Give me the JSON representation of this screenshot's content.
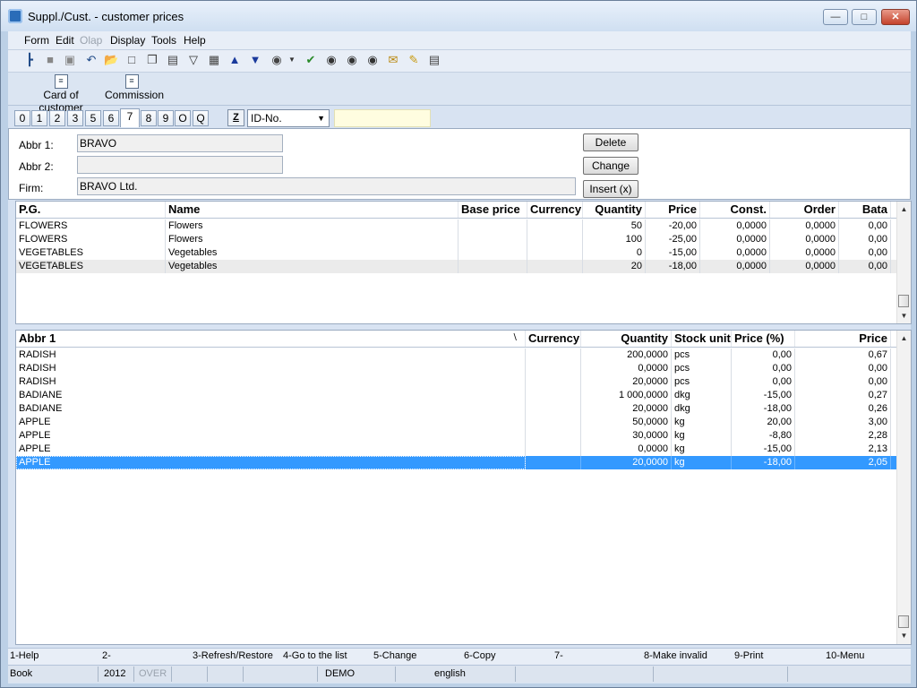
{
  "window": {
    "title": "Suppl./Cust. - customer prices"
  },
  "menu": {
    "items": [
      "Form",
      "Edit",
      "Olap",
      "Display",
      "Tools",
      "Help"
    ]
  },
  "toolbar2": {
    "card_of_customer": "Card of customer",
    "commission": "Commission"
  },
  "tabs": [
    "0",
    "1",
    "2",
    "3",
    "5",
    "6",
    "7",
    "8",
    "9",
    "O",
    "Q"
  ],
  "active_tab": "7",
  "filter": {
    "z_label": "Z",
    "select_value": "ID-No."
  },
  "form": {
    "abbr1_label": "Abbr 1:",
    "abbr1_value": "BRAVO",
    "abbr2_label": "Abbr 2:",
    "abbr2_value": "",
    "firm_label": "Firm:",
    "firm_value": "BRAVO Ltd.",
    "delete_label": "Delete",
    "change_label": "Change",
    "insert_label": "Insert (x)"
  },
  "grid1": {
    "headers": [
      "P.G.",
      "Name",
      "Base price",
      "Currency",
      "Quantity",
      "Price",
      "Const.",
      "Order",
      "Bata"
    ],
    "rows": [
      [
        "FLOWERS",
        "Flowers",
        "",
        "",
        "50",
        "-20,00",
        "0,0000",
        "0,0000",
        "0,00"
      ],
      [
        "FLOWERS",
        "Flowers",
        "",
        "",
        "100",
        "-25,00",
        "0,0000",
        "0,0000",
        "0,00"
      ],
      [
        "VEGETABLES",
        "Vegetables",
        "",
        "",
        "0",
        "-15,00",
        "0,0000",
        "0,0000",
        "0,00"
      ],
      [
        "VEGETABLES",
        "Vegetables",
        "",
        "",
        "20",
        "-18,00",
        "0,0000",
        "0,0000",
        "0,00"
      ]
    ]
  },
  "grid2": {
    "headers": [
      "Abbr 1",
      "Currency",
      "Quantity",
      "Stock unit",
      "Price (%)",
      "Price"
    ],
    "rows": [
      [
        "RADISH",
        "",
        "200,0000",
        "pcs",
        "0,00",
        "0,67"
      ],
      [
        "RADISH",
        "",
        "0,0000",
        "pcs",
        "0,00",
        "0,00"
      ],
      [
        "RADISH",
        "",
        "20,0000",
        "pcs",
        "0,00",
        "0,00"
      ],
      [
        "BADIANE",
        "",
        "1 000,0000",
        "dkg",
        "-15,00",
        "0,27"
      ],
      [
        "BADIANE",
        "",
        "20,0000",
        "dkg",
        "-18,00",
        "0,26"
      ],
      [
        "APPLE",
        "",
        "50,0000",
        "kg",
        "20,00",
        "3,00"
      ],
      [
        "APPLE",
        "",
        "30,0000",
        "kg",
        "-8,80",
        "2,28"
      ],
      [
        "APPLE",
        "",
        "0,0000",
        "kg",
        "-15,00",
        "2,13"
      ],
      [
        "APPLE",
        "",
        "20,0000",
        "kg",
        "-18,00",
        "2,05"
      ]
    ]
  },
  "fkeys": [
    "1-Help",
    "2-",
    "3-Refresh/Restore",
    "4-Go to the list",
    "5-Change",
    "6-Copy",
    "7-",
    "8-Make invalid",
    "9-Print",
    "10-Menu"
  ],
  "status": {
    "book": "Book",
    "year": "2012",
    "over": "OVER",
    "db": "DEMO",
    "lang": "english"
  },
  "colors": {
    "selection": "#3399ff",
    "accent": "#2a6cb8"
  }
}
